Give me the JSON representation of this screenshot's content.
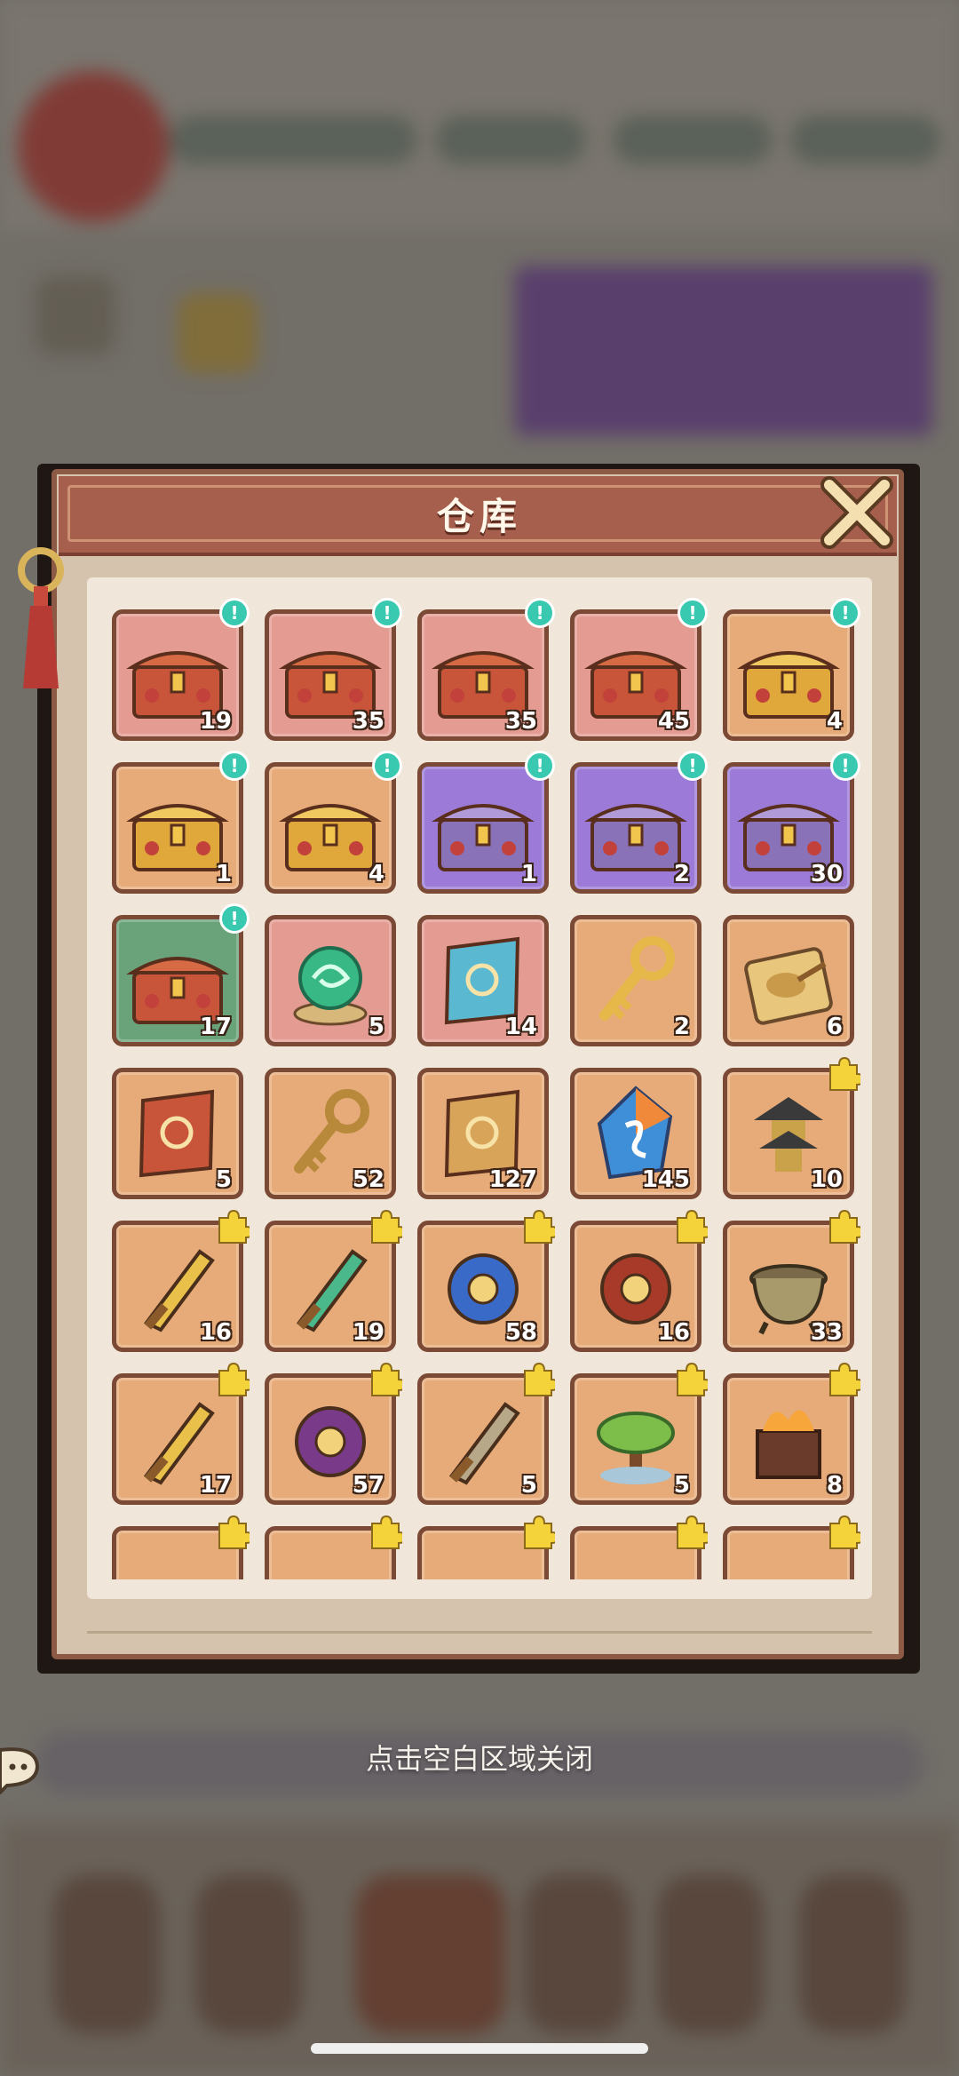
{
  "window": {
    "title": "仓库",
    "close_hint": "点击空白区域关闭"
  },
  "items": [
    {
      "icon": "chest-red-icon",
      "count": "19",
      "rarity": "pink",
      "badge": "exclaim"
    },
    {
      "icon": "chest-red-icon",
      "count": "35",
      "rarity": "pink",
      "badge": "exclaim"
    },
    {
      "icon": "chest-red-icon",
      "count": "35",
      "rarity": "pink",
      "badge": "exclaim"
    },
    {
      "icon": "chest-red-icon",
      "count": "45",
      "rarity": "pink",
      "badge": "exclaim"
    },
    {
      "icon": "chest-gold-dragon-icon",
      "count": "4",
      "rarity": "orange",
      "badge": "exclaim"
    },
    {
      "icon": "chest-gold-jade-icon",
      "count": "1",
      "rarity": "orange",
      "badge": "exclaim"
    },
    {
      "icon": "chest-gold-eggs-icon",
      "count": "4",
      "rarity": "orange",
      "badge": "exclaim"
    },
    {
      "icon": "chest-purple-puzzle-icon",
      "count": "1",
      "rarity": "purple",
      "badge": "exclaim"
    },
    {
      "icon": "chest-purple-gems-icon",
      "count": "2",
      "rarity": "purple",
      "badge": "exclaim"
    },
    {
      "icon": "chest-purple-fire-icon",
      "count": "30",
      "rarity": "purple",
      "badge": "exclaim"
    },
    {
      "icon": "chest-red-icon",
      "count": "17",
      "rarity": "green",
      "badge": "exclaim"
    },
    {
      "icon": "green-orb-icon",
      "count": "5",
      "rarity": "pink",
      "badge": ""
    },
    {
      "icon": "scroll-blue-icon",
      "count": "14",
      "rarity": "pink",
      "badge": ""
    },
    {
      "icon": "gold-key-swirl-icon",
      "count": "2",
      "rarity": "orange",
      "badge": ""
    },
    {
      "icon": "spoon-plate-icon",
      "count": "6",
      "rarity": "orange",
      "badge": ""
    },
    {
      "icon": "red-scroll-icon",
      "count": "5",
      "rarity": "orange",
      "badge": ""
    },
    {
      "icon": "bronze-key-icon",
      "count": "52",
      "rarity": "orange",
      "badge": ""
    },
    {
      "icon": "paper-talisman-icon",
      "count": "127",
      "rarity": "orange",
      "badge": ""
    },
    {
      "icon": "swirl-crystal-icon",
      "count": "145",
      "rarity": "orange",
      "badge": ""
    },
    {
      "icon": "pagoda-icon",
      "count": "10",
      "rarity": "orange",
      "badge": "piece"
    },
    {
      "icon": "golden-axe-icon",
      "count": "16",
      "rarity": "orange",
      "badge": "piece"
    },
    {
      "icon": "jade-claw-icon",
      "count": "19",
      "rarity": "orange",
      "badge": "piece"
    },
    {
      "icon": "blue-orb-mirror-icon",
      "count": "58",
      "rarity": "orange",
      "badge": "piece"
    },
    {
      "icon": "fire-wheel-icon",
      "count": "16",
      "rarity": "orange",
      "badge": "piece"
    },
    {
      "icon": "bronze-cauldron-icon",
      "count": "33",
      "rarity": "orange",
      "badge": "piece"
    },
    {
      "icon": "golden-sword-icon",
      "count": "17",
      "rarity": "orange",
      "badge": "piece"
    },
    {
      "icon": "purple-bracelet-icon",
      "count": "57",
      "rarity": "orange",
      "badge": "piece"
    },
    {
      "icon": "crossed-halberds-icon",
      "count": "5",
      "rarity": "orange",
      "badge": "piece"
    },
    {
      "icon": "bonsai-tree-icon",
      "count": "5",
      "rarity": "orange",
      "badge": "piece"
    },
    {
      "icon": "fire-brazier-icon",
      "count": "8",
      "rarity": "orange",
      "badge": "piece"
    },
    {
      "icon": "partial-item-icon",
      "count": "",
      "rarity": "orange",
      "badge": "piece"
    },
    {
      "icon": "partial-item-icon",
      "count": "",
      "rarity": "orange",
      "badge": "piece"
    },
    {
      "icon": "partial-item-icon",
      "count": "",
      "rarity": "orange",
      "badge": "piece"
    },
    {
      "icon": "partial-item-icon",
      "count": "",
      "rarity": "orange",
      "badge": "piece"
    },
    {
      "icon": "partial-item-icon",
      "count": "",
      "rarity": "orange",
      "badge": "piece"
    }
  ],
  "colors": {
    "pink": "#e49b92",
    "orange": "#e7ab7a",
    "purple": "#9c7ad8",
    "green": "#6aa37a",
    "badge": "#38c9b0",
    "header": "#a55f4c"
  }
}
